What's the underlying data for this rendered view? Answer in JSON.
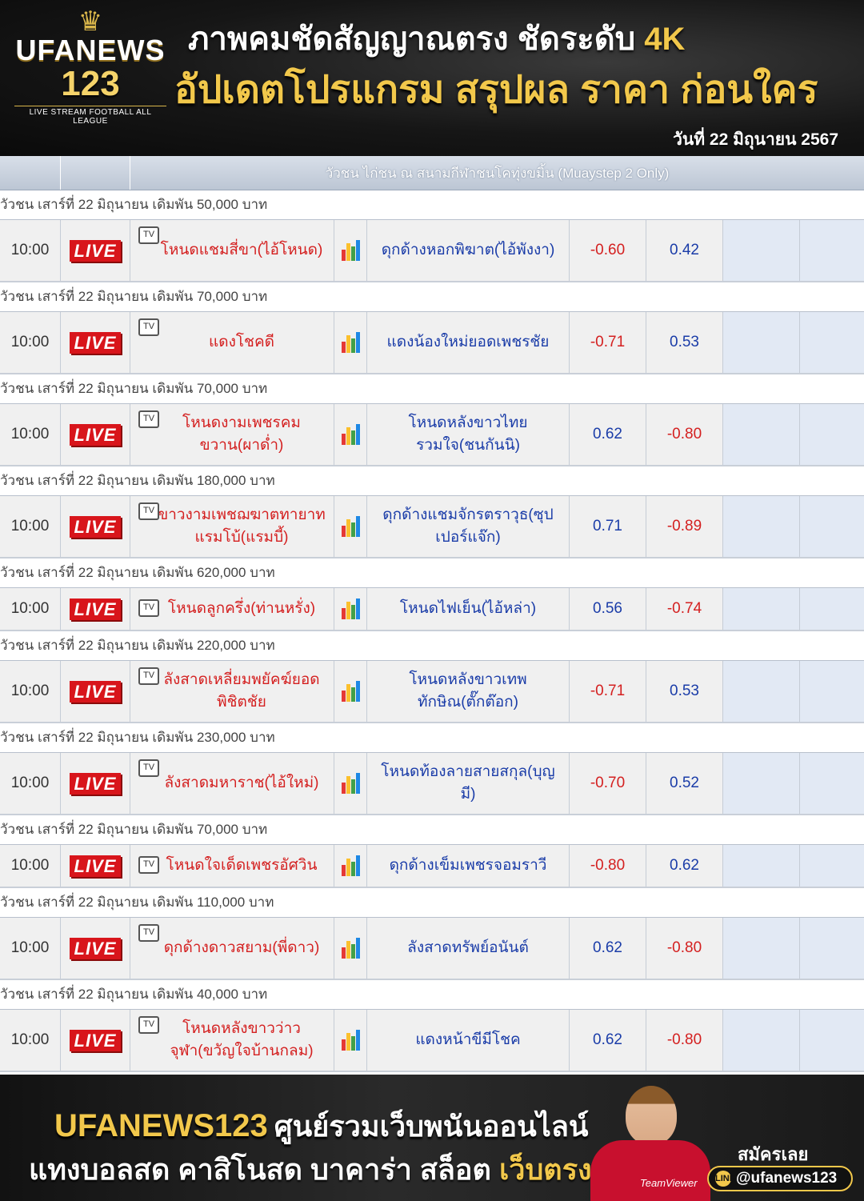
{
  "header": {
    "brand": "UFANEWS",
    "brand_num": "123",
    "brand_tagline": "LIVE STREAM FOOTBALL ALL LEAGUE",
    "line1_a": "ภาพคมชัดสัญญาณตรง ชัดระดับ",
    "line1_b": "4K",
    "line2": "อัปเดตโปรแกรม สรุปผล ราคา ก่อนใคร",
    "date": "วันที่ 22 มิถุนายน 2567"
  },
  "table": {
    "venue": "วัวชน ไก่ชน ณ สนามกีฬาชนโคทุ่งขมิ้น (Muaystep 2 Only)",
    "live_label": "LIVE",
    "tv_glyph": "TV",
    "rows": [
      {
        "group": "วัวชน เสาร์ที่ 22 มิถุนายน เดิมพัน 50,000 บาท",
        "time": "10:00",
        "home": "โหนดแชมสี่ขา(ไอ้โหนด)",
        "away": "ดุกด้างหอกพิฆาต(ไอ้พังงา)",
        "odd1": "-0.60",
        "odd2": "0.42",
        "size": "tall"
      },
      {
        "group": "วัวชน เสาร์ที่ 22 มิถุนายน เดิมพัน 70,000 บาท",
        "time": "10:00",
        "home": "แดงโชคดี",
        "away": "แดงน้องใหม่ยอดเพชรชัย",
        "odd1": "-0.71",
        "odd2": "0.53",
        "size": "tall"
      },
      {
        "group": "วัวชน เสาร์ที่ 22 มิถุนายน เดิมพัน 70,000 บาท",
        "time": "10:00",
        "home": "โหนดงามเพชรคมขวาน(ผาด่ำ)",
        "away": "โหนดหลังขาวไทยรวมใจ(ชนกันนิ)",
        "odd1": "0.62",
        "odd2": "-0.80",
        "size": "tall"
      },
      {
        "group": "วัวชน เสาร์ที่ 22 มิถุนายน เดิมพัน 180,000 บาท",
        "time": "10:00",
        "home": "ขาวงามเพชฌฆาตทายาทแรมโบ้(แรมบี้)",
        "away": "ดุกด้างแชมจักรตราวุธ(ซุปเปอร์แจ๊ก)",
        "odd1": "0.71",
        "odd2": "-0.89",
        "size": "tall"
      },
      {
        "group": "วัวชน เสาร์ที่ 22 มิถุนายน เดิมพัน 620,000 บาท",
        "time": "10:00",
        "home": "โหนดลูกครึ่ง(ท่านหรั่ง)",
        "away": "โหนดไฟเย็น(ไอ้หล่า)",
        "odd1": "0.56",
        "odd2": "-0.74",
        "size": "short"
      },
      {
        "group": "วัวชน เสาร์ที่ 22 มิถุนายน เดิมพัน 220,000 บาท",
        "time": "10:00",
        "home": "ลังสาดเหลี่ยมพยัคฆ์ยอดพิชิตชัย",
        "away": "โหนดหลังขาวเทพทักษิณ(ตั๊กต๊อก)",
        "odd1": "-0.71",
        "odd2": "0.53",
        "size": "tall"
      },
      {
        "group": "วัวชน เสาร์ที่ 22 มิถุนายน เดิมพัน 230,000 บาท",
        "time": "10:00",
        "home": "ลังสาดมหาราช(ไอ้ใหม่)",
        "away": "โหนดท้องลายสายสกุล(บุญมี)",
        "odd1": "-0.70",
        "odd2": "0.52",
        "size": "tall"
      },
      {
        "group": "วัวชน เสาร์ที่ 22 มิถุนายน เดิมพัน 70,000 บาท",
        "time": "10:00",
        "home": "โหนดใจเด็ดเพชรอัศวิน",
        "away": "ดุกด้างเข็มเพชรจอมราวี",
        "odd1": "-0.80",
        "odd2": "0.62",
        "size": "short"
      },
      {
        "group": "วัวชน เสาร์ที่ 22 มิถุนายน เดิมพัน 110,000 บาท",
        "time": "10:00",
        "home": "ดุกด้างดาวสยาม(พี่ดาว)",
        "away": "ลังสาดทรัพย์อนันต์",
        "odd1": "0.62",
        "odd2": "-0.80",
        "size": "tall"
      },
      {
        "group": "วัวชน เสาร์ที่ 22 มิถุนายน เดิมพัน 40,000 บาท",
        "time": "10:00",
        "home": "โหนดหลังขาวว่าวจุฬา(ขวัญใจบ้านกลม)",
        "away": "แดงหน้าขีมีโชค",
        "odd1": "0.62",
        "odd2": "-0.80",
        "size": "tall"
      }
    ]
  },
  "footer": {
    "brand": "UFANEWS123",
    "tagline": "ศูนย์รวมเว็บพนันออนไลน์",
    "line2": "แทงบอลสด คาสิโนสด บาคาร่า สล็อต",
    "line2_highlight": "เว็บตรง",
    "signup": "สมัครเลย",
    "handle": "@ufanews123",
    "handle_icon": "LINE",
    "sponsor": "TeamViewer"
  },
  "colors": {
    "gold": "#f2c84b",
    "live_red": "#d8151b",
    "home_red": "#d42020",
    "away_blue": "#1a3ca8",
    "header_bar": "#bcc6d4"
  }
}
